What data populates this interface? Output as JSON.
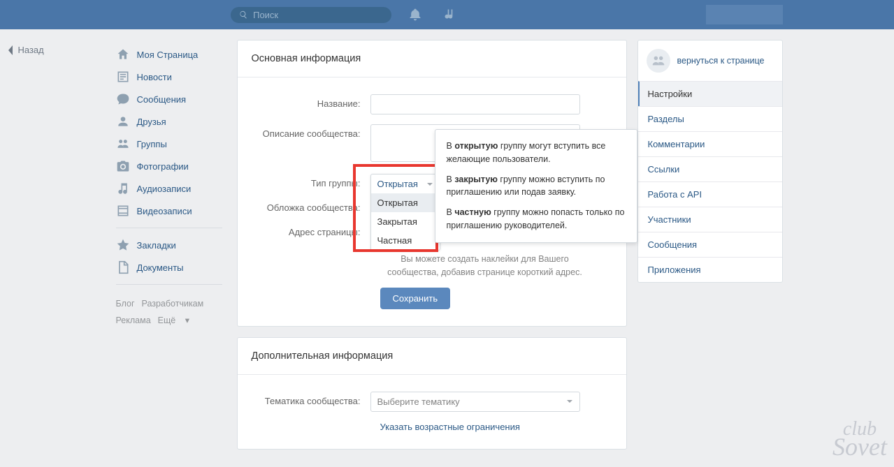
{
  "header": {
    "search_placeholder": "Поиск"
  },
  "back_label": "Назад",
  "sidebar_nav": [
    {
      "id": "my-page",
      "label": "Моя Страница"
    },
    {
      "id": "news",
      "label": "Новости"
    },
    {
      "id": "messages",
      "label": "Сообщения"
    },
    {
      "id": "friends",
      "label": "Друзья"
    },
    {
      "id": "groups",
      "label": "Группы"
    },
    {
      "id": "photos",
      "label": "Фотографии"
    },
    {
      "id": "audio",
      "label": "Аудиозаписи"
    },
    {
      "id": "video",
      "label": "Видеозаписи"
    }
  ],
  "sidebar_nav2": [
    {
      "id": "bookmarks",
      "label": "Закладки"
    },
    {
      "id": "documents",
      "label": "Документы"
    }
  ],
  "footer": {
    "blog": "Блог",
    "devs": "Разработчикам",
    "ads": "Реклама",
    "more": "Ещё"
  },
  "panel1": {
    "title": "Основная информация",
    "name_label": "Название:",
    "desc_label": "Описание сообщества:",
    "type_label": "Тип группы:",
    "cover_label": "Обложка сообщества:",
    "addr_label": "Адрес страницы:",
    "hint": "Вы можете создать наклейки для Вашего сообщества, добавив странице короткий адрес.",
    "save": "Сохранить"
  },
  "dropdown": {
    "selected": "Открытая",
    "options": [
      "Открытая",
      "Закрытая",
      "Частная"
    ]
  },
  "tooltip": {
    "p1a": "В ",
    "p1b": "открытую",
    "p1c": " группу могут вступить все желающие пользователи.",
    "p2a": "В ",
    "p2b": "закрытую",
    "p2c": " группу можно вступить по приглашению или подав заявку.",
    "p3a": "В ",
    "p3b": "частную",
    "p3c": " группу можно попасть только по приглашению руководителей."
  },
  "panel2": {
    "title": "Дополнительная информация",
    "topic_label": "Тематика сообщества:",
    "topic_placeholder": "Выберите тематику",
    "age_link": "Указать возрастные ограничения"
  },
  "right": {
    "back": "вернуться к странице",
    "items": [
      "Настройки",
      "Разделы",
      "Комментарии",
      "Ссылки",
      "Работа с API",
      "Участники",
      "Сообщения",
      "Приложения"
    ]
  },
  "watermark_top": "club",
  "watermark_bottom": "Sovet"
}
